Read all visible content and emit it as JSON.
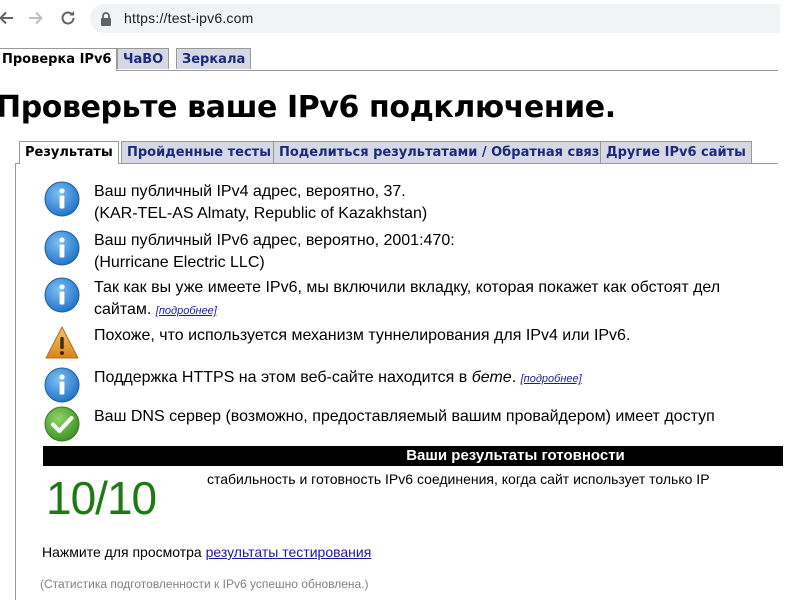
{
  "browser": {
    "url": "https://test-ipv6.com"
  },
  "site_tabs": [
    {
      "label": "Проверка IPv6"
    },
    {
      "label": "ЧаВО"
    },
    {
      "label": "Зеркала"
    }
  ],
  "headline": "Проверьте ваше IPv6 подключение.",
  "inner_tabs": [
    {
      "label": "Результаты"
    },
    {
      "label": "Пройденные тесты"
    },
    {
      "label": "Поделиться результатами / Обратная связь"
    },
    {
      "label": "Другие IPv6 сайты"
    }
  ],
  "results": [
    {
      "icon": "info-icon",
      "line1": "Ваш публичный IPv4 адрес, вероятно, 37.",
      "line2": "(KAR-TEL-AS Almaty, Republic of Kazakhstan)"
    },
    {
      "icon": "info-icon",
      "line1": "Ваш публичный IPv6 адрес, вероятно, 2001:470:",
      "line2": "(Hurricane Electric LLC)"
    },
    {
      "icon": "info-icon",
      "line1": "Так как вы уже имеете IPv6, мы включили вкладку, которая покажет как обстоят дел",
      "line2": "сайтам.",
      "more": "[подробнее]"
    },
    {
      "icon": "warning-icon",
      "line1": "Похоже, что используется механизм туннелирования для IPv4 или IPv6."
    },
    {
      "icon": "info-icon",
      "line1_a": "Поддержка HTTPS на этом веб-сайте находится в ",
      "line1_em": "бете",
      "line1_b": ".",
      "more": "[подробнее]"
    },
    {
      "icon": "check-icon",
      "line1": "Ваш DNS сервер (возможно, предоставляемый вашим провайдером) имеет доступ"
    }
  ],
  "readiness": {
    "header": "Ваши результаты готовности",
    "score": "10/10",
    "description": "стабильность и готовность IPv6 соединения, когда сайт использует только IP"
  },
  "footer": {
    "prompt": "Нажмите для просмотра ",
    "link": "результаты тестирования",
    "stats_note": "(Статистика подготовленности к IPv6 успешно обновлена.)"
  },
  "colors": {
    "score": "#1b7a12",
    "info": "#2d7fd0",
    "warning": "#e39a2a",
    "check": "#4ba62c"
  }
}
